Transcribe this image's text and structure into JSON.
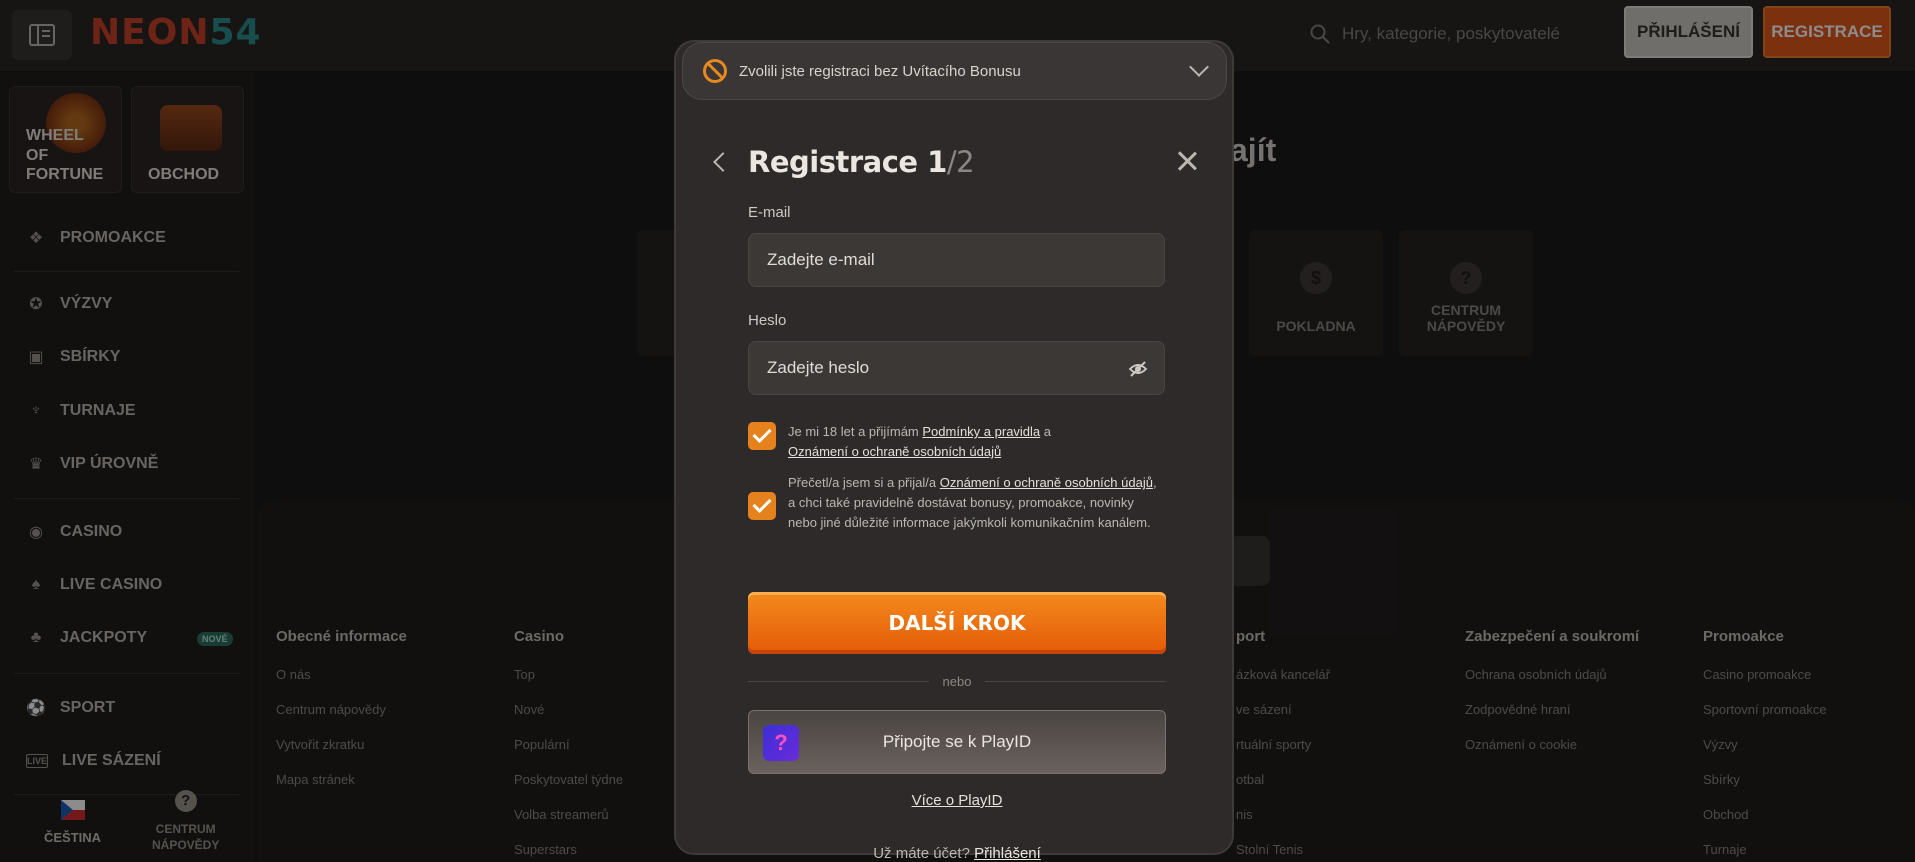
{
  "header": {
    "logo_prefix": "NEON",
    "logo_suffix": "54",
    "search_placeholder": "Hry, kategorie, poskytovatelé",
    "login_label": "PŘIHLÁŠENÍ",
    "register_label": "REGISTRACE"
  },
  "sidebar": {
    "tiles": [
      {
        "label": "WHEEL OF FORTUNE"
      },
      {
        "label": "OBCHOD"
      }
    ],
    "items": [
      {
        "label": "PROMOAKCE",
        "icon": "gift-icon"
      },
      {
        "label": "VÝZVY",
        "icon": "medal-icon"
      },
      {
        "label": "SBÍRKY",
        "icon": "chest-icon"
      },
      {
        "label": "TURNAJE",
        "icon": "trophy-icon"
      },
      {
        "label": "VIP ÚROVNĚ",
        "icon": "crown-icon"
      },
      {
        "label": "CASINO",
        "icon": "chip-icon"
      },
      {
        "label": "LIVE CASINO",
        "icon": "cards-icon"
      },
      {
        "label": "JACKPOTY",
        "icon": "clover-icon",
        "badge": "NOVÉ"
      },
      {
        "label": "SPORT",
        "icon": "ball-icon"
      },
      {
        "label": "LIVE SÁZENÍ",
        "icon": "live-icon"
      }
    ],
    "language": "ČEŠTINA",
    "help_line1": "CENTRUM",
    "help_line2": "NÁPOVĚDY"
  },
  "main": {
    "headline": "ajít",
    "quick_links": [
      {
        "label": "POKLADNA"
      },
      {
        "label": "CENTRUM NÁPOVĚDY"
      }
    ],
    "footer_columns": [
      {
        "title": "Obecné informace",
        "links": [
          "O nás",
          "Centrum nápovědy",
          "Vytvořit zkratku",
          "Mapa stránek"
        ]
      },
      {
        "title": "Casino",
        "links": [
          "Top",
          "Nové",
          "Populární",
          "Poskytovatel týdne",
          "Volba streamerů",
          "Superstars"
        ]
      },
      {
        "title": "port",
        "links": [
          "ázková kancelář",
          "ve sázení",
          "rtuální sporty",
          "otbal",
          "nis",
          "Stolní Tenis"
        ]
      },
      {
        "title": "Zabezpečení a soukromí",
        "links": [
          "Ochrana osobních údajů",
          "Zodpovědné hraní",
          "Oznámení o cookie"
        ]
      },
      {
        "title": "Promoakce",
        "links": [
          "Casino promoakce",
          "Sportovní promoakce",
          "Výzvy",
          "Sbírky",
          "Obchod",
          "Turnaje"
        ]
      }
    ]
  },
  "modal": {
    "bonus_notice": "Zvolili jste registraci bez Uvítacího Bonusu",
    "title": "Registrace",
    "step": "1",
    "total": "/2",
    "email_label": "E-mail",
    "email_placeholder": "Zadejte e-mail",
    "password_label": "Heslo",
    "password_placeholder": "Zadejte heslo",
    "consent1_prefix": "Je mi 18 let a přijímám ",
    "consent1_link1": "Podmínky a pravidla",
    "consent1_mid": " a",
    "consent1_link2": "Oznámení o ochraně osobních údajů",
    "consent2_prefix": "Přečetl/a jsem si a přijal/a ",
    "consent2_link": "Oznámení o ochraně osobních údajů",
    "consent2_suffix": ", a chci také pravidelně dostávat bonusy, promoakce, novinky nebo jiné důležité informace jakýmkoli komunikačním kanálem.",
    "next_label": "DALŠÍ KROK",
    "or_label": "nebo",
    "playid_label": "Připojte se k PlayID",
    "more_playid": "Více o PlayID",
    "have_account": "Už máte účet?",
    "login_link": "Přihlášení"
  },
  "colors": {
    "accent": "#e6821e",
    "brand_red": "#c9402a",
    "background": "#1c1b1b"
  }
}
